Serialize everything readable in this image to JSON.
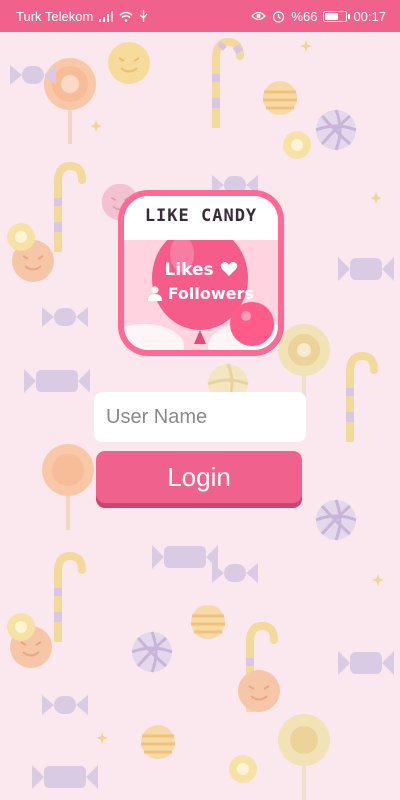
{
  "statusbar": {
    "carrier": "Turk Telekom",
    "battery_percent": "%66",
    "battery_level": 0.66,
    "time": "00:17",
    "icons": [
      "signal-icon",
      "wifi-icon",
      "usb-icon",
      "eye-icon",
      "alarm-icon",
      "battery-icon"
    ]
  },
  "logo": {
    "title": "LIKE CANDY",
    "line1": "Likes",
    "line2": "Followers",
    "icons": [
      "heart-icon",
      "user-icon"
    ]
  },
  "form": {
    "username_placeholder": "User Name",
    "username_value": "",
    "login_label": "Login"
  },
  "colors": {
    "statusbar": "#f0618b",
    "background": "#fbe8ee",
    "button": "#f0628e",
    "logo_frame": "#ff6a95"
  }
}
